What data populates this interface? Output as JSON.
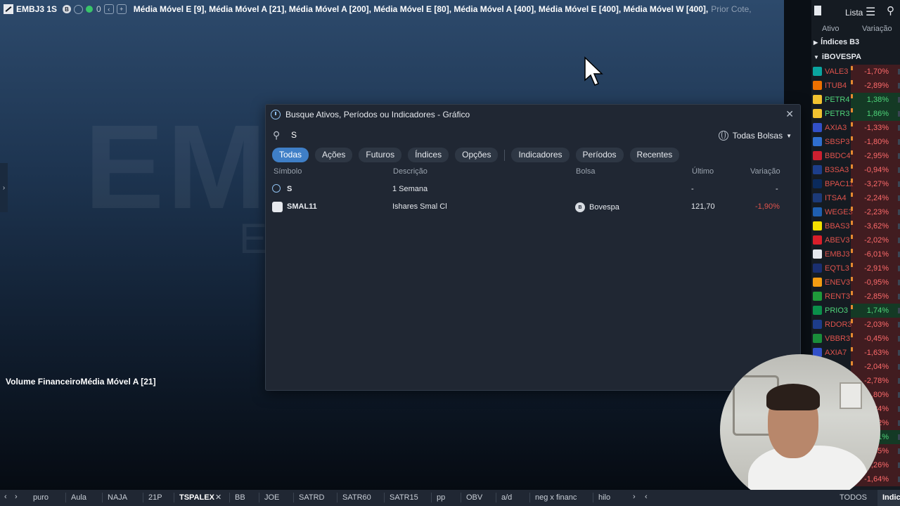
{
  "topbar": {
    "symbol": "EMBJ3 1S",
    "badge_count": "0",
    "indicators": "Média Móvel E [9], Média Móvel A [21], Média Móvel A [200], Média Móvel E [80], Média Móvel A [400], Média Móvel E [400], Média Móvel W [400],",
    "prior": "Prior Cote,"
  },
  "chart": {
    "watermark": "EMBJ3",
    "watermark_sub": "E",
    "volume_label": "Volume FinanceiroMédia Móvel A [21]"
  },
  "search": {
    "title": "Busque Ativos, Períodos ou Indicadores - Gráfico",
    "query": "S",
    "exchange": "Todas Bolsas",
    "filters": [
      "Todas",
      "Ações",
      "Futuros",
      "Índices",
      "Opções",
      "Indicadores",
      "Períodos",
      "Recentes"
    ],
    "columns": {
      "symbol": "Símbolo",
      "description": "Descrição",
      "exchange": "Bolsa",
      "last": "Último",
      "change": "Variação"
    },
    "results": [
      {
        "symbol": "S",
        "description": "1 Semana",
        "exchange": "",
        "last": "-",
        "change": "-"
      },
      {
        "symbol": "SMAL11",
        "description": "Ishares Smal Cl",
        "exchange": "Bovespa",
        "last": "121,70",
        "change": "-1,90%"
      }
    ]
  },
  "watchlist": {
    "title": "Lista",
    "col_asset": "Ativo",
    "col_change": "Variação",
    "groups": [
      "Índices B3",
      "iBOVESPA"
    ],
    "items": [
      {
        "ticker": "VALE3",
        "change": "-1,70%",
        "color": "#0aa5a0"
      },
      {
        "ticker": "ITUB4",
        "change": "-2,89%",
        "color": "#ec7000"
      },
      {
        "ticker": "PETR4",
        "change": "1,38%",
        "color": "#f2c230"
      },
      {
        "ticker": "PETR3",
        "change": "1,86%",
        "color": "#f2c230"
      },
      {
        "ticker": "AXIA3",
        "change": "-1,33%",
        "color": "#3250c8"
      },
      {
        "ticker": "SBSP3",
        "change": "-1,80%",
        "color": "#2f6fcf"
      },
      {
        "ticker": "BBDC4",
        "change": "-2,95%",
        "color": "#cc2030"
      },
      {
        "ticker": "B3SA3",
        "change": "-0,94%",
        "color": "#1d3e8a"
      },
      {
        "ticker": "BPAC11",
        "change": "-3,27%",
        "color": "#0a2a5c"
      },
      {
        "ticker": "ITSA4",
        "change": "-2,24%",
        "color": "#1c3a78"
      },
      {
        "ticker": "WEGE3",
        "change": "-2,23%",
        "color": "#1f5fb0"
      },
      {
        "ticker": "BBAS3",
        "change": "-3,62%",
        "color": "#f3e000"
      },
      {
        "ticker": "ABEV3",
        "change": "-2,02%",
        "color": "#d81e2a"
      },
      {
        "ticker": "EMBJ3",
        "change": "-6,01%",
        "color": "#e6e9ee"
      },
      {
        "ticker": "EQTL3",
        "change": "-2,91%",
        "color": "#1a2f70"
      },
      {
        "ticker": "ENEV3",
        "change": "-0,95%",
        "color": "#f39c12"
      },
      {
        "ticker": "RENT3",
        "change": "-2,85%",
        "color": "#1f9a3a"
      },
      {
        "ticker": "PRIO3",
        "change": "1,74%",
        "color": "#0a8f4a"
      },
      {
        "ticker": "RDOR3",
        "change": "-2,03%",
        "color": "#1d3c8a"
      },
      {
        "ticker": "VBBR3",
        "change": "-0,45%",
        "color": "#1a8d3a"
      },
      {
        "ticker": "AXIA7",
        "change": "-1,63%",
        "color": "#3250c8"
      },
      {
        "ticker": "",
        "change": "-2,04%",
        "color": "#3250c8"
      },
      {
        "ticker": "",
        "change": "-2,78%",
        "color": "#777777"
      },
      {
        "ticker": "",
        "change": "-1,80%",
        "color": "#777777"
      },
      {
        "ticker": "",
        "change": "-1,84%",
        "color": "#777777"
      },
      {
        "ticker": "",
        "change": "-2,52%",
        "color": "#777777"
      },
      {
        "ticker": "",
        "change": "0,21%",
        "color": "#777777"
      },
      {
        "ticker": "",
        "change": "-1,65%",
        "color": "#777777"
      },
      {
        "ticker": "",
        "change": "-0,26%",
        "color": "#777777"
      },
      {
        "ticker": "",
        "change": "-1,64%",
        "color": "#777777"
      }
    ]
  },
  "bottom": {
    "tabs": [
      "puro",
      "Aula",
      "NAJA",
      "21P",
      "TSPALEX",
      "BB",
      "JOE",
      "SATRD",
      "SATR60",
      "SATR15",
      "pp",
      "OBV",
      "a/d",
      "neg x financ",
      "hilo"
    ],
    "active_tab": "TSPALEX",
    "todos": "TODOS",
    "indic": "Indic"
  }
}
